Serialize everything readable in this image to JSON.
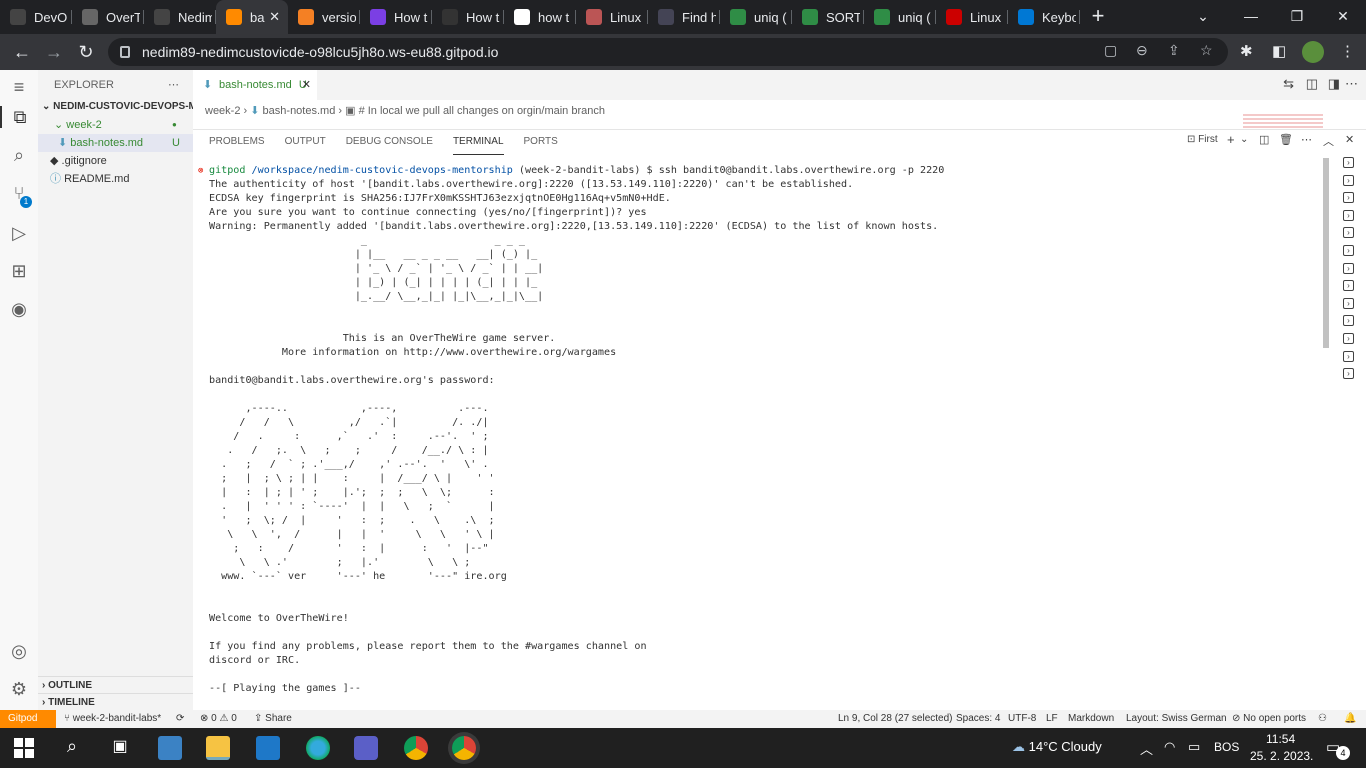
{
  "browser": {
    "tabs": [
      {
        "title": "DevOp",
        "icon": "github-icon"
      },
      {
        "title": "OverT",
        "icon": "overthewire-icon"
      },
      {
        "title": "Nedim",
        "icon": "github-icon"
      },
      {
        "title": "ba",
        "icon": "gitpod-icon",
        "active": true
      },
      {
        "title": "versio",
        "icon": "stackoverflow-icon"
      },
      {
        "title": "How t",
        "icon": "x-icon"
      },
      {
        "title": "How t",
        "icon": "devto-icon"
      },
      {
        "title": "how t",
        "icon": "google-icon"
      },
      {
        "title": "Linux",
        "icon": "avatar-icon"
      },
      {
        "title": "Find h",
        "icon": "codegrepper-icon"
      },
      {
        "title": "uniq (",
        "icon": "geeks-icon"
      },
      {
        "title": "SORT",
        "icon": "geeks-icon"
      },
      {
        "title": "uniq (",
        "icon": "geeks-icon"
      },
      {
        "title": "Linux",
        "icon": "vuln-icon"
      },
      {
        "title": "Keybo",
        "icon": "microsoft-icon"
      }
    ],
    "url": "nedim89-nedimcustovicde-o98lcu5jh8o.ws-eu88.gitpod.io"
  },
  "sidebar": {
    "title": "EXPLORER",
    "root": "NEDIM-CUSTOVIC-DEVOPS-ME...",
    "folder": "week-2",
    "file_active": "bash-notes.md",
    "file_active_badge": "U",
    "files": [
      ".gitignore",
      "README.md"
    ],
    "outline": "OUTLINE",
    "timeline": "TIMELINE",
    "scm_badge": "1"
  },
  "editor": {
    "tab_label": "bash-notes.md",
    "tab_badge": "U",
    "breadcrumb": [
      "week-2",
      "bash-notes.md",
      "# In local we pull all changes on orgin/main branch"
    ]
  },
  "panel": {
    "tabs": [
      "PROBLEMS",
      "OUTPUT",
      "DEBUG CONSOLE",
      "TERMINAL",
      "PORTS"
    ],
    "active_tab": "TERMINAL",
    "first_label": "First",
    "terminal": {
      "prompt_user": "gitpod",
      "prompt_path": "/workspace/nedim-custovic-devops-mentorship",
      "prompt_rest": " (week-2-bandit-labs) $ ssh bandit0@bandit.labs.overthewire.org -p 2220",
      "lines": [
        "The authenticity of host '[bandit.labs.overthewire.org]:2220 ([13.53.149.110]:2220)' can't be established.",
        "ECDSA key fingerprint is SHA256:IJ7FrX0mKSSHTJ63ezxjqtnOE0Hg116Aq+v5mN0+HdE.",
        "Are you sure you want to continue connecting (yes/no/[fingerprint])? yes",
        "Warning: Permanently added '[bandit.labs.overthewire.org]:2220,[13.53.149.110]:2220' (ECDSA) to the list of known hosts.",
        "                         _                     _ _ _   ",
        "                        | |__   __ _ _ __   __| (_) |_ ",
        "                        | '_ \\ / _` | '_ \\ / _` | | __|",
        "                        | |_) | (_| | | | | (_| | | |_ ",
        "                        |_.__/ \\__,_|_| |_|\\__,_|_|\\__|",
        "",
        "",
        "                      This is an OverTheWire game server.",
        "            More information on http://www.overthewire.org/wargames",
        "",
        "bandit0@bandit.labs.overthewire.org's password:",
        "",
        "      ,----..            ,----,          .---.",
        "     /   /   \\         ,/   .`|         /. ./|",
        "    /   .     :      ,`   .'  :     .--'.  ' ;",
        "   .   /   ;.  \\   ;    ;     /    /__./ \\ : |",
        "  .   ;   /  ` ; .'___,/    ,' .--'.  '   \\' .",
        "  ;   |  ; \\ ; | |    :     |  /___/ \\ |    ' '",
        "  |   :  | ; | ' ;    |.';  ;  ;   \\  \\;      :",
        "  .   |  ' ' ' : `----'  |  |   \\   ;  `      |",
        "  '   ;  \\; /  |     '   :  ;    .   \\    .\\  ;",
        "   \\   \\  ',  /      |   |  '     \\   \\   ' \\ |",
        "    ;   :    /       '   :  |      :   '  |--\"",
        "     \\   \\ .'        ;   |.'        \\   \\ ;",
        "  www. `---` ver     '---' he       '---\" ire.org",
        "",
        "",
        "Welcome to OverTheWire!",
        "",
        "If you find any problems, please report them to the #wargames channel on",
        "discord or IRC.",
        "",
        "--[ Playing the games ]--"
      ]
    }
  },
  "statusbar": {
    "remote": "Gitpod",
    "branch": "week-2-bandit-labs*",
    "errors": "0",
    "warnings": "0",
    "share": "Share",
    "position": "Ln 9, Col 28 (27 selected)",
    "spaces": "Spaces: 4",
    "encoding": "UTF-8",
    "eol": "LF",
    "language": "Markdown",
    "layout": "Layout: Swiss German",
    "ports": "No open ports"
  },
  "taskbar": {
    "weather": "14°C  Cloudy",
    "lang": "BOS",
    "time": "11:54",
    "date": "25. 2. 2023.",
    "notif_count": "4"
  },
  "colors": {
    "accent_gitpod": "#ff8a00",
    "prompt_green": "#188a3f",
    "prompt_blue": "#0451a5"
  }
}
